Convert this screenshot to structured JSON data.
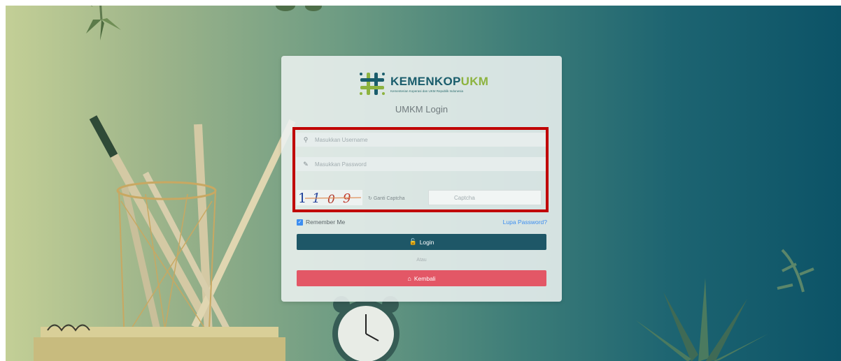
{
  "brand": {
    "name_part1": "KEMENKOP",
    "name_part2": "UKM",
    "tagline": "Kementerian Koperasi dan UKM Republik Indonesia",
    "color_primary": "#1a5d6c",
    "color_accent": "#8db33f"
  },
  "login": {
    "title": "UMKM Login",
    "username_placeholder": "Masukkan Username",
    "username_icon": "user-icon",
    "password_placeholder": "Masukkan Password",
    "password_icon": "pencil-icon",
    "captcha_code": "1109",
    "refresh_captcha_label": "Ganti Captcha",
    "captcha_placeholder": "Captcha",
    "remember_label": "Remember Me",
    "remember_checked": true,
    "forgot_label": "Lupa Password?",
    "login_button": "Login",
    "login_icon": "lock-icon",
    "or_label": "Atau",
    "back_button": "Kembali",
    "back_icon": "home-icon"
  },
  "colors": {
    "highlight_border": "#c00000",
    "login_button_bg": "#1e5767",
    "back_button_bg": "#e35766",
    "link": "#3d8ef0"
  }
}
